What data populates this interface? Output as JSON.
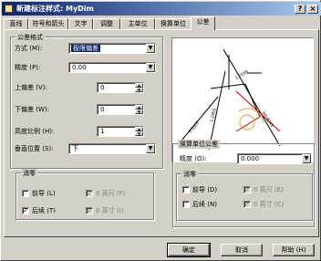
{
  "window": {
    "title": "新建标注样式: MyDim",
    "close": "×",
    "help": "?"
  },
  "tabs": [
    "直线",
    "符号和箭头",
    "文字",
    "调整",
    "主单位",
    "换算单位",
    "公差"
  ],
  "tolerance_format": {
    "legend": "公差格式",
    "method_label": "方式 (M):",
    "method_value": "极限偏差",
    "precision_label": "精度 (P):",
    "precision_value": "0.00",
    "upper_label": "上偏差 (V):",
    "upper_value": "0",
    "lower_label": "下偏差 (W):",
    "lower_value": "0",
    "height_label": "高度比例 (H):",
    "height_value": "1",
    "vpos_label": "垂直位置 (S):",
    "vpos_value": "下"
  },
  "zero_left": {
    "legend": "消零",
    "leading": "前导 (L)",
    "trailing": "后续 (T)",
    "feet": "0 英尺 (F)",
    "inches": "0 英寸 (I)",
    "leading_checked": "",
    "trailing_checked": "✓",
    "feet_checked": "✓",
    "inches_checked": "✓"
  },
  "alt_units": {
    "legend": "换算单位公差",
    "precision_label": "精度 (O):",
    "precision_value": "0.000"
  },
  "zero_right": {
    "legend": "消零",
    "leading": "前导 (D)",
    "trailing": "后续 (N)",
    "feet": "0 英尺 (E)",
    "inches": "0 英寸 (C)",
    "feet_checked": "✓",
    "inches_checked": "✓"
  },
  "buttons": {
    "ok": "确定",
    "cancel": "取消",
    "help": "帮助 (H)"
  },
  "colors": {
    "title_start": "#0a246a",
    "title_end": "#a6caf0",
    "selection": "#0a246a"
  }
}
